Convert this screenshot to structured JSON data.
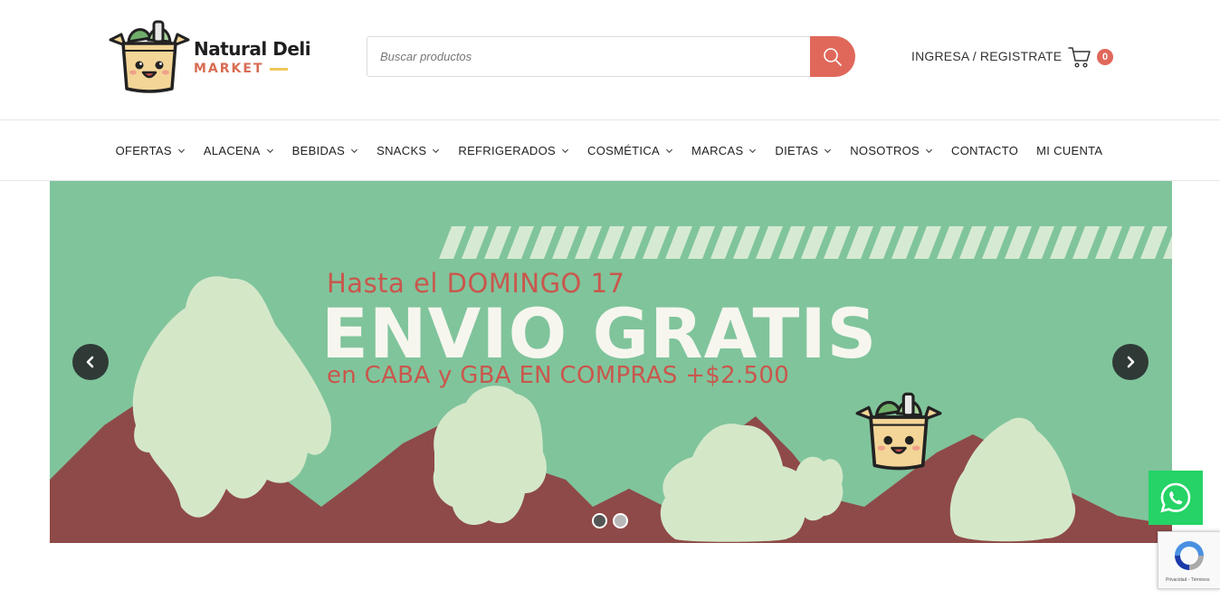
{
  "header": {
    "logo": {
      "title": "Natural Deli",
      "subtitle": "MARKET"
    },
    "search": {
      "placeholder": "Buscar productos"
    },
    "login_label": "INGRESA / REGISTRATE",
    "cart": {
      "count": "0",
      "icon": "cart-icon"
    }
  },
  "nav": {
    "items": [
      {
        "label": "OFERTAS",
        "has_dropdown": true
      },
      {
        "label": "ALACENA",
        "has_dropdown": true
      },
      {
        "label": "BEBIDAS",
        "has_dropdown": true
      },
      {
        "label": "SNACKS",
        "has_dropdown": true
      },
      {
        "label": "REFRIGERADOS",
        "has_dropdown": true
      },
      {
        "label": "COSMÉTICA",
        "has_dropdown": true
      },
      {
        "label": "MARCAS",
        "has_dropdown": true
      },
      {
        "label": "DIETAS",
        "has_dropdown": true
      },
      {
        "label": "NOSOTROS",
        "has_dropdown": true
      },
      {
        "label": "CONTACTO",
        "has_dropdown": false
      },
      {
        "label": "MI CUENTA",
        "has_dropdown": false
      }
    ]
  },
  "hero": {
    "line1": "Hasta el DOMINGO 17",
    "line2": "ENVIO GRATIS",
    "line3": "en CABA y GBA EN COMPRAS +$2.500",
    "slides_total": 2,
    "active_slide": 1
  },
  "widgets": {
    "whatsapp_icon": "whatsapp-icon",
    "recaptcha_text": "Privacidad - Términos"
  },
  "colors": {
    "accent": "#e0685b",
    "hero_bg": "#80c49c",
    "mountain": "#8e4a48",
    "tree": "#d4e8c8",
    "whatsapp": "#25d366"
  }
}
